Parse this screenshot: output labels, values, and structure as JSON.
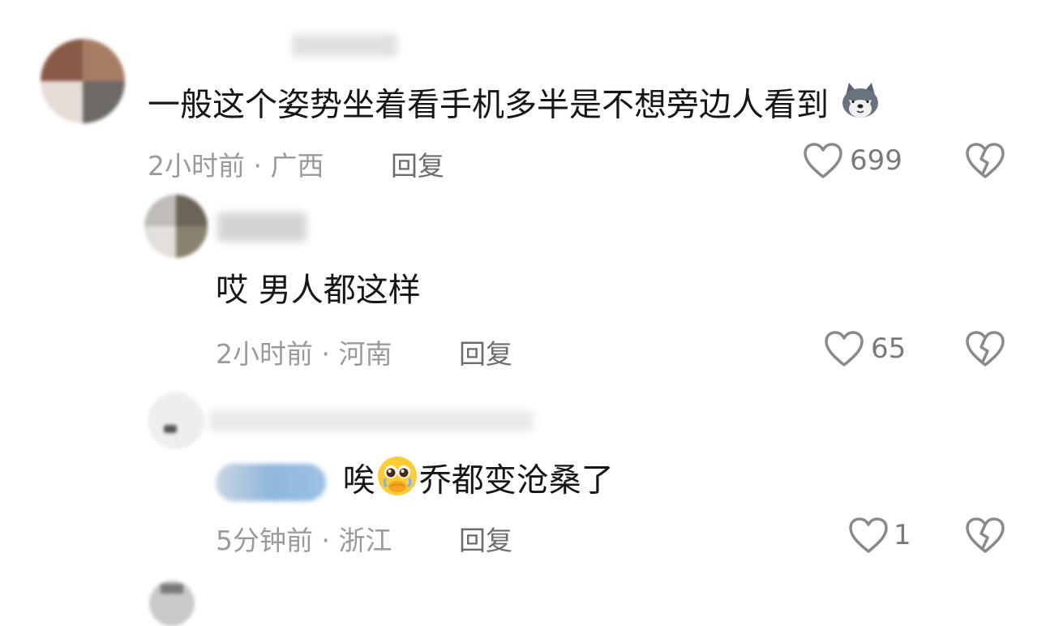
{
  "comments": [
    {
      "text": "一般这个姿势坐着看手机多半是不想旁边人看到",
      "emoji": "wolf-emoji",
      "time": "2小时前",
      "location": "广西",
      "reply_label": "回复",
      "likes": "699"
    },
    {
      "text": "哎 男人都这样",
      "time": "2小时前",
      "location": "河南",
      "reply_label": "回复",
      "likes": "65"
    },
    {
      "text_before": "唉",
      "emoji": "pleading-face-emoji",
      "text_after": "乔都变沧桑了",
      "time": "5分钟前",
      "location": "浙江",
      "reply_label": "回复",
      "likes": "1"
    }
  ],
  "separator": "·",
  "icons": {
    "like": "heart-outline-icon",
    "dislike": "broken-heart-icon"
  },
  "colors": {
    "text": "#161616",
    "meta": "#9a9a9a",
    "reply": "#6c6c6c",
    "icon": "#8a8a8a"
  }
}
